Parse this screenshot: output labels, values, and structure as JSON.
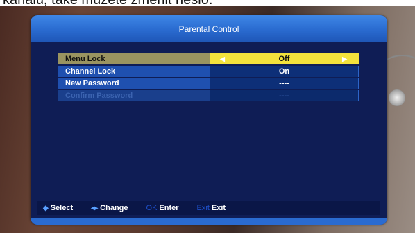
{
  "caption": {
    "text": "kanálu, také můžete změnit heslo."
  },
  "window": {
    "title": "Parental Control"
  },
  "menu": {
    "items": [
      {
        "label": "Menu Lock",
        "value": "Off",
        "state": "selected"
      },
      {
        "label": "Channel Lock",
        "value": "On",
        "state": "normal"
      },
      {
        "label": "New Password",
        "value": "----",
        "state": "normal"
      },
      {
        "label": "Confirm Password",
        "value": "----",
        "state": "disabled"
      }
    ]
  },
  "footer": {
    "select": {
      "icon": "up-down-arrows-icon",
      "label": "Select"
    },
    "change": {
      "icon": "left-right-arrows-icon",
      "label": "Change"
    },
    "enter": {
      "key": "OK",
      "label": "Enter"
    },
    "exit": {
      "key": "Exit",
      "label": "Exit"
    }
  },
  "colors": {
    "header": "#2a6bd0",
    "panel": "#0f1d55",
    "selected_value": "#f3e23c",
    "selected_label": "#9a9460",
    "row_label": "#1f50b0",
    "row_value": "#0d2f78"
  }
}
